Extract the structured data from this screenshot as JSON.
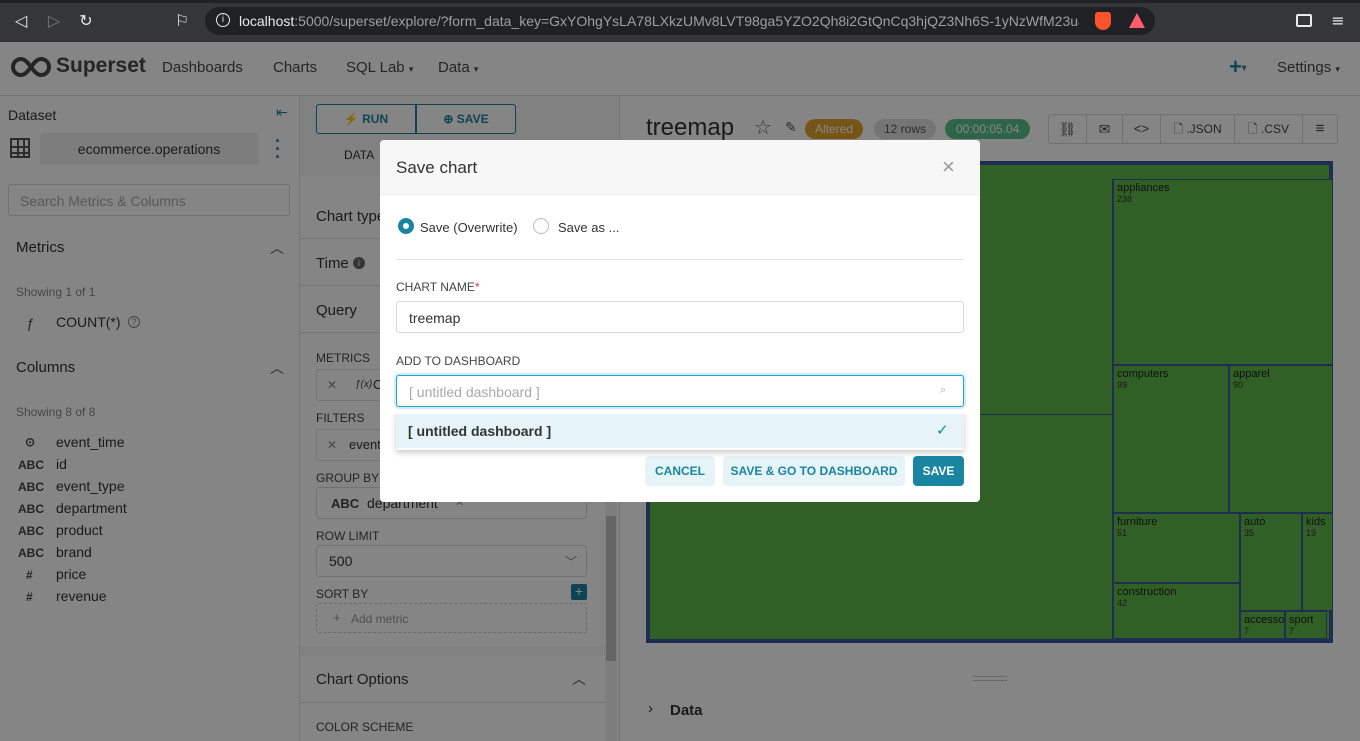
{
  "browser": {
    "url_host": "localhost",
    "url_rest": ":5000/superset/explore/?form_data_key=GxYOhgYsLA78LXkzUMv8LVT98ga5YZO2Qh8i2GtQnCq3hjQZ3Nh6S-1yNzWfM23u&..."
  },
  "navbar": {
    "brand": "Superset",
    "links": [
      "Dashboards",
      "Charts",
      "SQL Lab",
      "Data"
    ],
    "plus": "+",
    "settings": "Settings"
  },
  "datasource": {
    "header": "Dataset",
    "name": "ecommerce.operations",
    "search_placeholder": "Search Metrics & Columns",
    "metrics_title": "Metrics",
    "metrics_showing": "Showing 1 of 1",
    "metrics": [
      {
        "type": "ƒ",
        "name": "COUNT(*)"
      }
    ],
    "columns_title": "Columns",
    "columns_showing": "Showing 8 of 8",
    "columns": [
      {
        "type": "⊙",
        "name": "event_time"
      },
      {
        "type": "ABC",
        "name": "id"
      },
      {
        "type": "ABC",
        "name": "event_type"
      },
      {
        "type": "ABC",
        "name": "department"
      },
      {
        "type": "ABC",
        "name": "product"
      },
      {
        "type": "ABC",
        "name": "brand"
      },
      {
        "type": "#",
        "name": "price"
      },
      {
        "type": "#",
        "name": "revenue"
      }
    ]
  },
  "controls": {
    "run": "RUN",
    "save": "SAVE",
    "tab_data": "DATA",
    "chart_type": "Chart type",
    "time": "Time",
    "query": "Query",
    "metrics_label": "METRICS",
    "metrics_value": "C",
    "filters_label": "FILTERS",
    "filters_value": "event",
    "group_by_label": "GROUP BY",
    "group_by_value": "department",
    "group_by_type": "ABC",
    "row_limit_label": "ROW LIMIT",
    "row_limit_value": "500",
    "sort_by_label": "SORT BY",
    "add_metric": "Add metric",
    "chart_options": "Chart Options",
    "color_scheme": "COLOR SCHEME"
  },
  "chart": {
    "title": "treemap",
    "altered": "Altered",
    "rows": "12 rows",
    "timer": "00:00:05.04",
    "json": ".JSON",
    "csv": ".CSV",
    "data_section": "Data"
  },
  "chart_data": {
    "type": "treemap",
    "values": [
      {
        "name": "appliances",
        "value": 238
      },
      {
        "name": "computers",
        "value": 99
      },
      {
        "name": "apparel",
        "value": 90
      },
      {
        "name": "furniture",
        "value": 51
      },
      {
        "name": "construction",
        "value": 42
      },
      {
        "name": "auto",
        "value": 35
      },
      {
        "name": "kids",
        "value": 19
      },
      {
        "name": "accesso",
        "value": 7
      },
      {
        "name": "sport",
        "value": 7
      }
    ]
  },
  "modal": {
    "title": "Save chart",
    "radio_overwrite": "Save (Overwrite)",
    "radio_save_as": "Save as ...",
    "chart_name_label": "CHART NAME",
    "chart_name_value": "treemap",
    "dashboard_label": "ADD TO DASHBOARD",
    "dashboard_placeholder": "[ untitled dashboard ]",
    "dropdown_option": "[ untitled dashboard ]",
    "cancel": "CANCEL",
    "save_go": "SAVE & GO TO DASHBOARD",
    "save": "SAVE"
  },
  "colors": {
    "primary": "#20a7c9",
    "accent_dark": "#1a85a0",
    "altered": "#e5a32c",
    "timer": "#5ac189",
    "treemap_fill": "#5cb848",
    "treemap_border": "#3d57a0"
  }
}
